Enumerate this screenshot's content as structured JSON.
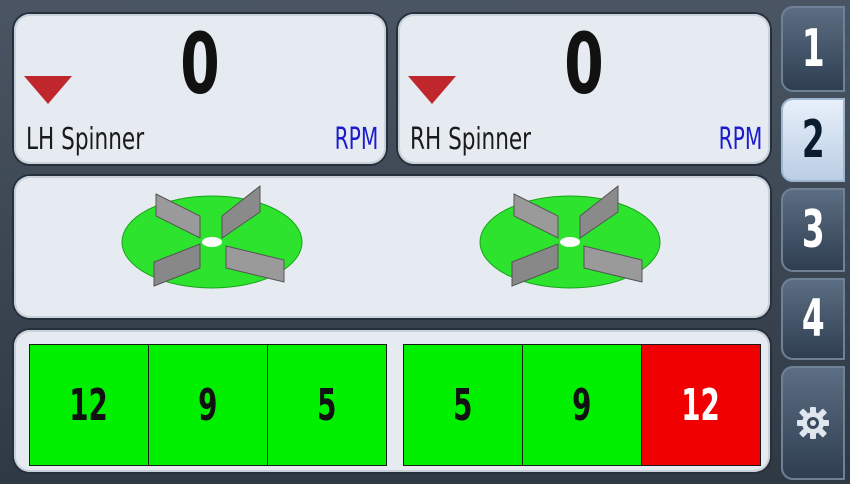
{
  "left": {
    "rpm": "0",
    "label": "LH Spinner",
    "unit": "RPM",
    "bars": [
      {
        "value": "12",
        "color": "#00f000"
      },
      {
        "value": "9",
        "color": "#00f000"
      },
      {
        "value": "5",
        "color": "#00f000"
      }
    ]
  },
  "right": {
    "rpm": "0",
    "label": "RH Spinner",
    "unit": "RPM",
    "bars": [
      {
        "value": "5",
        "color": "#00f000"
      },
      {
        "value": "9",
        "color": "#00f000"
      },
      {
        "value": "12",
        "color": "#f00000"
      }
    ]
  },
  "nav": {
    "items": [
      {
        "label": "1",
        "active": false
      },
      {
        "label": "2",
        "active": true
      },
      {
        "label": "3",
        "active": false
      },
      {
        "label": "4",
        "active": false
      }
    ],
    "settings_icon": "gear-icon"
  },
  "colors": {
    "indicator": "#c0272d",
    "unit_text": "#1c1ccc",
    "disc": "#2de32d",
    "blade": "#8f8f8f"
  }
}
